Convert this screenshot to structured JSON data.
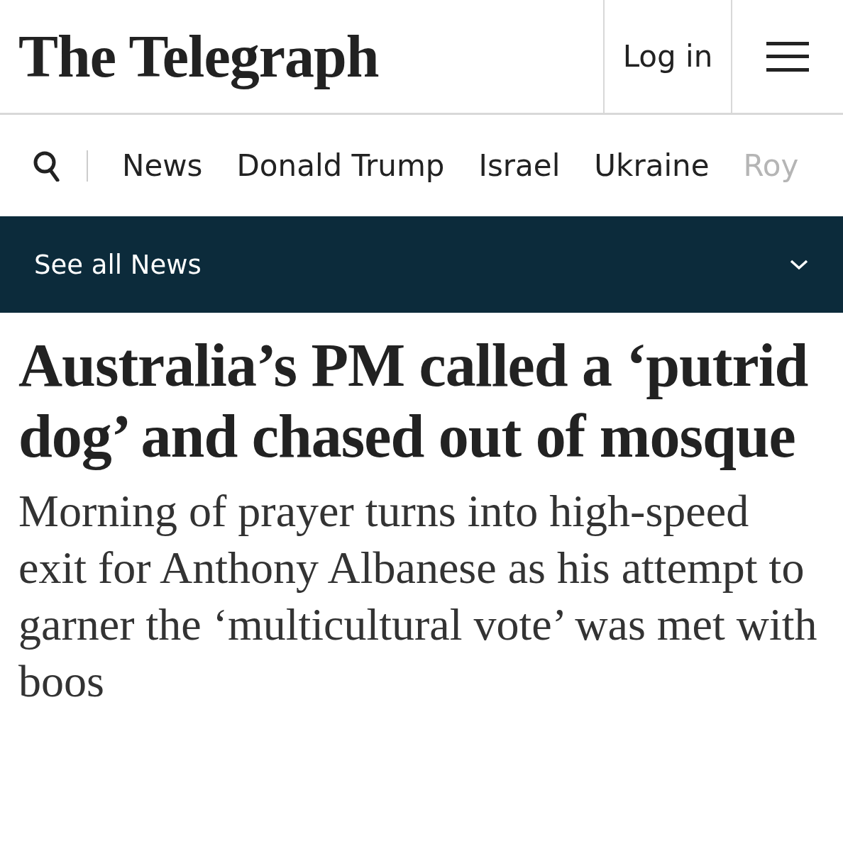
{
  "header": {
    "logo": "The Telegraph",
    "login": "Log in"
  },
  "nav": {
    "items": [
      {
        "label": "News",
        "faded": false
      },
      {
        "label": "Donald Trump",
        "faded": false
      },
      {
        "label": "Israel",
        "faded": false
      },
      {
        "label": "Ukraine",
        "faded": false
      },
      {
        "label": "Roy",
        "faded": true
      }
    ]
  },
  "section_bar": {
    "label": "See all News",
    "expanded": false
  },
  "article": {
    "headline": "Australia’s PM called a ‘putrid dog’ and chased out of mosque",
    "standfirst": "Morning of prayer turns into high-speed exit for Anthony Albanese as his attempt to garner the ‘multicultural vote’ was met with boos"
  }
}
